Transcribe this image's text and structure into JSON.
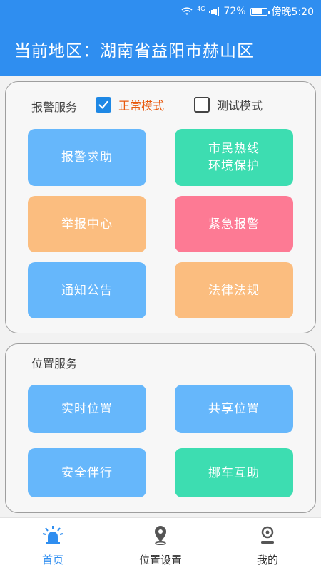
{
  "status_bar": {
    "network": "4G",
    "battery": "72%",
    "time": "傍晚5:20"
  },
  "header": {
    "title": "当前地区：湖南省益阳市赫山区"
  },
  "alarm_section": {
    "title": "报警服务",
    "mode_normal": {
      "label": "正常模式",
      "checked": true
    },
    "mode_test": {
      "label": "测试模式",
      "checked": false
    },
    "tiles": {
      "help": "报警求助",
      "hotline_line1": "市民热线",
      "hotline_line2": "环境保护",
      "report": "举报中心",
      "emergency": "紧急报警",
      "notice": "通知公告",
      "law": "法律法规"
    }
  },
  "location_section": {
    "title": "位置服务",
    "tiles": {
      "realtime": "实时位置",
      "share": "共享位置",
      "companion": "安全伴行",
      "move_car": "挪车互助"
    }
  },
  "bottom_nav": {
    "home": "首页",
    "location_settings": "位置设置",
    "mine": "我的"
  },
  "colors": {
    "primary": "#2f8ef0",
    "tile_blue": "#66b7fb",
    "tile_green": "#3dddb1",
    "tile_orange": "#fbbd7f",
    "tile_pink": "#fd7a94",
    "mode_active": "#e8580c"
  }
}
